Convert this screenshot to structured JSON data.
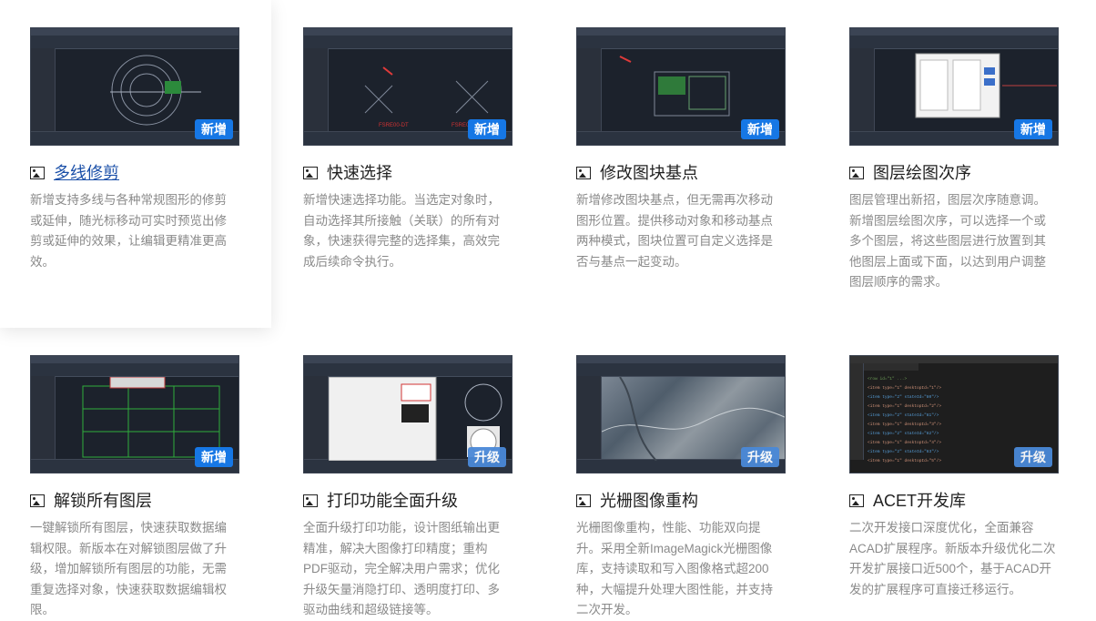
{
  "features": [
    {
      "title": "多线修剪",
      "badge": "新增",
      "desc": "新增支持多线与各种常规图形的修剪或延伸，随光标移动可实时预览出修剪或延伸的效果，让编辑更精准更高效。"
    },
    {
      "title": "快速选择",
      "badge": "新增",
      "desc": "新增快速选择功能。当选定对象时，自动选择其所接触（关联）的所有对象，快速获得完整的选择集，高效完成后续命令执行。"
    },
    {
      "title": "修改图块基点",
      "badge": "新增",
      "desc": "新增修改图块基点，但无需再次移动图形位置。提供移动对象和移动基点两种模式，图块位置可自定义选择是否与基点一起变动。"
    },
    {
      "title": "图层绘图次序",
      "badge": "新增",
      "desc": "图层管理出新招，图层次序随意调。新增图层绘图次序，可以选择一个或多个图层，将这些图层进行放置到其他图层上面或下面，以达到用户调整图层顺序的需求。"
    },
    {
      "title": "解锁所有图层",
      "badge": "新增",
      "desc": "一键解锁所有图层，快速获取数据编辑权限。新版本在对解锁图层做了升级，增加解锁所有图层的功能，无需重复选择对象，快速获取数据编辑权限。"
    },
    {
      "title": "打印功能全面升级",
      "badge": "升级",
      "desc": "全面升级打印功能，设计图纸输出更精准，解决大图像打印精度；重构PDF驱动，完全解决用户需求；优化升级矢量消隐打印、透明度打印、多驱动曲线和超级链接等。"
    },
    {
      "title": "光栅图像重构",
      "badge": "升级",
      "desc": "光栅图像重构，性能、功能双向提升。采用全新ImageMagick光栅图像库，支持读取和写入图像格式超200种，大幅提升处理大图性能，并支持二次开发。"
    },
    {
      "title": "ACET开发库",
      "badge": "升级",
      "desc": "二次开发接口深度优化，全面兼容ACAD扩展程序。新版本升级优化二次开发扩展接口近500个，基于ACAD开发的扩展程序可直接迁移运行。"
    }
  ]
}
